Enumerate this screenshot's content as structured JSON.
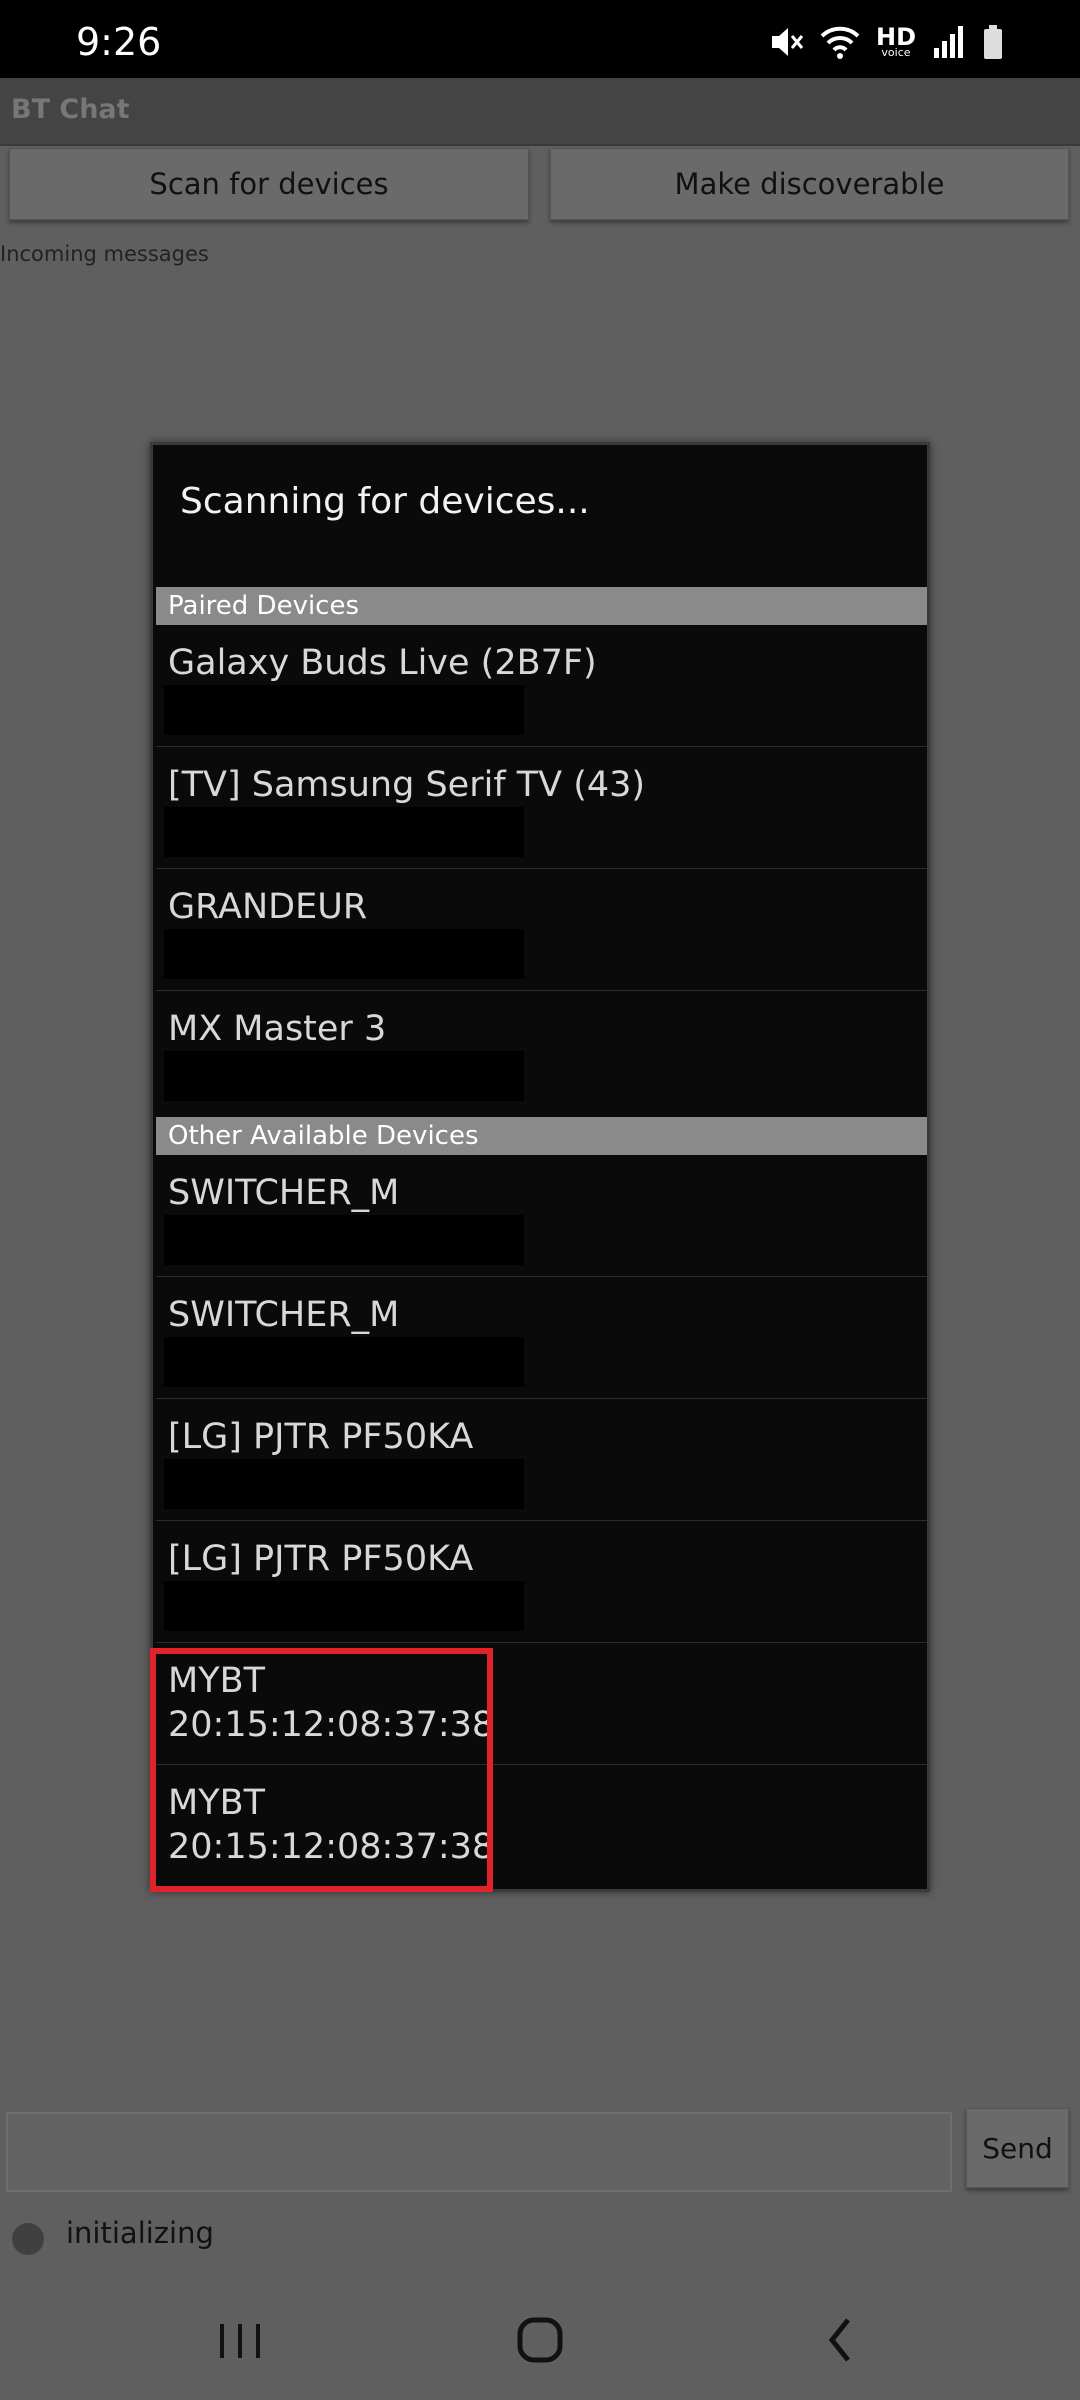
{
  "status_bar": {
    "time": "9:26",
    "hd_label": "HD",
    "voice_label": "voice"
  },
  "app": {
    "title": "BT Chat",
    "scan_button": "Scan for devices",
    "discoverable_button": "Make discoverable",
    "incoming_label": "Incoming messages",
    "send_button": "Send",
    "status_text": "initializing"
  },
  "dialog": {
    "title": "Scanning for devices...",
    "paired_header": "Paired Devices",
    "paired": [
      {
        "name": "Galaxy Buds Live (2B7F)"
      },
      {
        "name": "[TV] Samsung Serif TV (43)"
      },
      {
        "name": "GRANDEUR"
      },
      {
        "name": "MX Master 3"
      }
    ],
    "other_header": "Other Available Devices",
    "other": [
      {
        "name": "SWITCHER_M"
      },
      {
        "name": "SWITCHER_M"
      },
      {
        "name": "[LG] PJTR PF50KA"
      },
      {
        "name": "[LG] PJTR PF50KA"
      },
      {
        "name": "MYBT",
        "address": "20:15:12:08:37:38"
      },
      {
        "name": "MYBT",
        "address": "20:15:12:08:37:38"
      }
    ]
  },
  "colors": {
    "highlight": "#e0232b",
    "dialog_bg": "#0a0a0a",
    "section_header_bg": "#8a8a8a"
  }
}
